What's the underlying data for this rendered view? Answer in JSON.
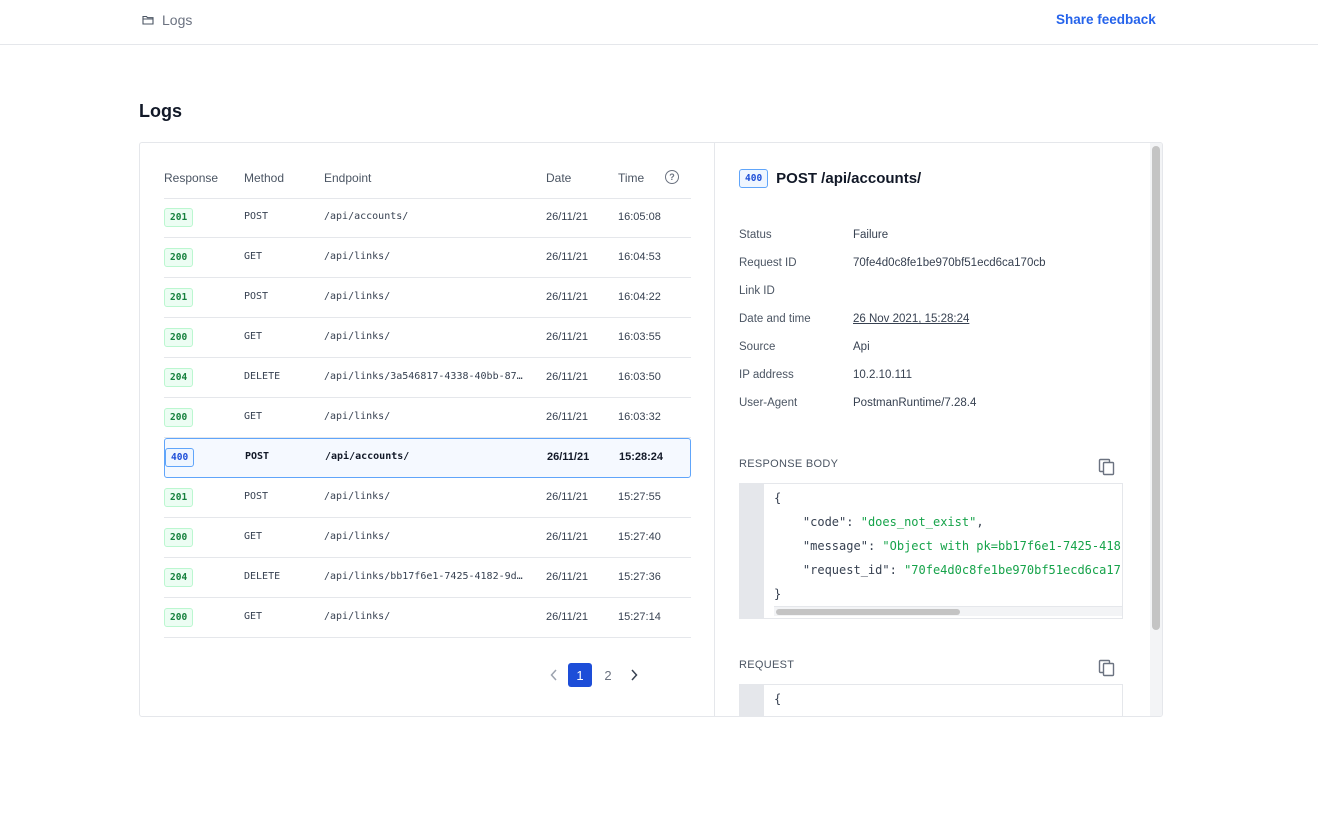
{
  "header": {
    "breadcrumb": "Logs",
    "share_feedback": "Share feedback"
  },
  "page": {
    "title": "Logs"
  },
  "table": {
    "columns": {
      "response": "Response",
      "method": "Method",
      "endpoint": "Endpoint",
      "date": "Date",
      "time": "Time"
    },
    "rows": [
      {
        "status": "201",
        "method": "POST",
        "endpoint": "/api/accounts/",
        "date": "26/11/21",
        "time": "16:05:08"
      },
      {
        "status": "200",
        "method": "GET",
        "endpoint": "/api/links/",
        "date": "26/11/21",
        "time": "16:04:53"
      },
      {
        "status": "201",
        "method": "POST",
        "endpoint": "/api/links/",
        "date": "26/11/21",
        "time": "16:04:22"
      },
      {
        "status": "200",
        "method": "GET",
        "endpoint": "/api/links/",
        "date": "26/11/21",
        "time": "16:03:55"
      },
      {
        "status": "204",
        "method": "DELETE",
        "endpoint": "/api/links/3a546817-4338-40bb-87…",
        "date": "26/11/21",
        "time": "16:03:50"
      },
      {
        "status": "200",
        "method": "GET",
        "endpoint": "/api/links/",
        "date": "26/11/21",
        "time": "16:03:32"
      },
      {
        "status": "400",
        "method": "POST",
        "endpoint": "/api/accounts/",
        "date": "26/11/21",
        "time": "15:28:24"
      },
      {
        "status": "201",
        "method": "POST",
        "endpoint": "/api/links/",
        "date": "26/11/21",
        "time": "15:27:55"
      },
      {
        "status": "200",
        "method": "GET",
        "endpoint": "/api/links/",
        "date": "26/11/21",
        "time": "15:27:40"
      },
      {
        "status": "204",
        "method": "DELETE",
        "endpoint": "/api/links/bb17f6e1-7425-4182-9d…",
        "date": "26/11/21",
        "time": "15:27:36"
      },
      {
        "status": "200",
        "method": "GET",
        "endpoint": "/api/links/",
        "date": "26/11/21",
        "time": "15:27:14"
      }
    ]
  },
  "pagination": {
    "pages": [
      "1",
      "2"
    ],
    "current": "1"
  },
  "detail": {
    "status_code": "400",
    "title": "POST /api/accounts/",
    "fields": [
      {
        "label": "Status",
        "value": "Failure"
      },
      {
        "label": "Request ID",
        "value": "70fe4d0c8fe1be970bf51ecd6ca170cb"
      },
      {
        "label": "Link ID",
        "value": ""
      },
      {
        "label": "Date and time",
        "value": "26 Nov 2021, 15:28:24"
      },
      {
        "label": "Source",
        "value": "Api"
      },
      {
        "label": "IP address",
        "value": "10.2.10.111"
      },
      {
        "label": "User-Agent",
        "value": "PostmanRuntime/7.28.4"
      }
    ],
    "response_body_label": "RESPONSE BODY",
    "response_body": {
      "open": "{",
      "code_key": "\"code\"",
      "code_val": "\"does_not_exist\"",
      "message_key": "\"message\"",
      "message_val": "\"Object with pk=bb17f6e1-7425-418",
      "request_id_key": "\"request_id\"",
      "request_id_val": "\"70fe4d0c8fe1be970bf51ecd6ca17",
      "close": "}"
    },
    "request_label": "REQUEST",
    "request_body": {
      "open": "{"
    }
  },
  "colors": {
    "accent": "#1d4ed8",
    "link": "#2563eb",
    "success": "#15803d",
    "string": "#16a34a"
  }
}
